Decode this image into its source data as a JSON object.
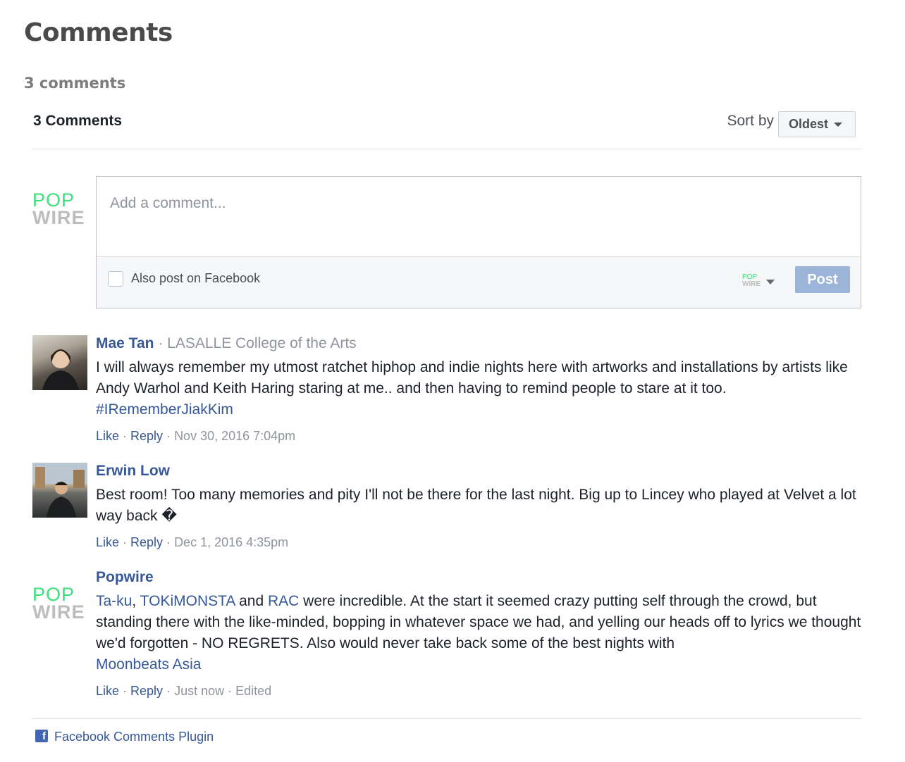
{
  "page_title": "Comments",
  "comment_count": "3 comments",
  "plugin": {
    "count_label": "3 Comments",
    "sort_label": "Sort by",
    "sort_value": "Oldest"
  },
  "composer": {
    "logo_pop": "POP",
    "logo_wire": "WIRE",
    "placeholder": "Add a comment...",
    "also_post_label": "Also post on Facebook",
    "post_button": "Post"
  },
  "comments": [
    {
      "author": "Mae Tan",
      "separator": "·",
      "organization": "LASALLE College of the Arts",
      "text": "I will always remember my utmost ratchet hiphop and indie nights here with artworks and installations by artists like Andy Warhol and Keith Haring staring at me.. and then having to remind people to stare at it too.",
      "hashtag": "#IRememberJiakKim",
      "like": "Like",
      "reply": "Reply",
      "timestamp": "Nov 30, 2016 7:04pm"
    },
    {
      "author": "Erwin Low",
      "text": "Best room! Too many memories and pity I'll not be there for the last night. Big up to Lincey who played at Velvet a lot way back �",
      "like": "Like",
      "reply": "Reply",
      "timestamp": "Dec 1, 2016 4:35pm"
    },
    {
      "author": "Popwire",
      "logo_pop": "POP",
      "logo_wire": "WIRE",
      "mention_1": "Ta-ku",
      "comma": ",",
      "mention_2": "TOKiMONSTA",
      "and_word": "and",
      "mention_3": "RAC",
      "text": "were incredible. At the start it seemed crazy putting self through the crowd, but standing there with the like-minded, bopping in whatever space we had, and yelling our heads off to lyrics we thought we'd forgotten - NO REGRETS. Also would never take back some of the best nights with",
      "mention_4": "Moonbeats Asia",
      "like": "Like",
      "reply": "Reply",
      "timestamp": "Just now",
      "edited": "Edited"
    }
  ],
  "footer": {
    "icon_letter": "f",
    "link": "Facebook Comments Plugin"
  },
  "colors": {
    "link_blue": "#365899",
    "post_button_disabled": "#9cb4d8",
    "logo_green": "#3ee07a"
  }
}
